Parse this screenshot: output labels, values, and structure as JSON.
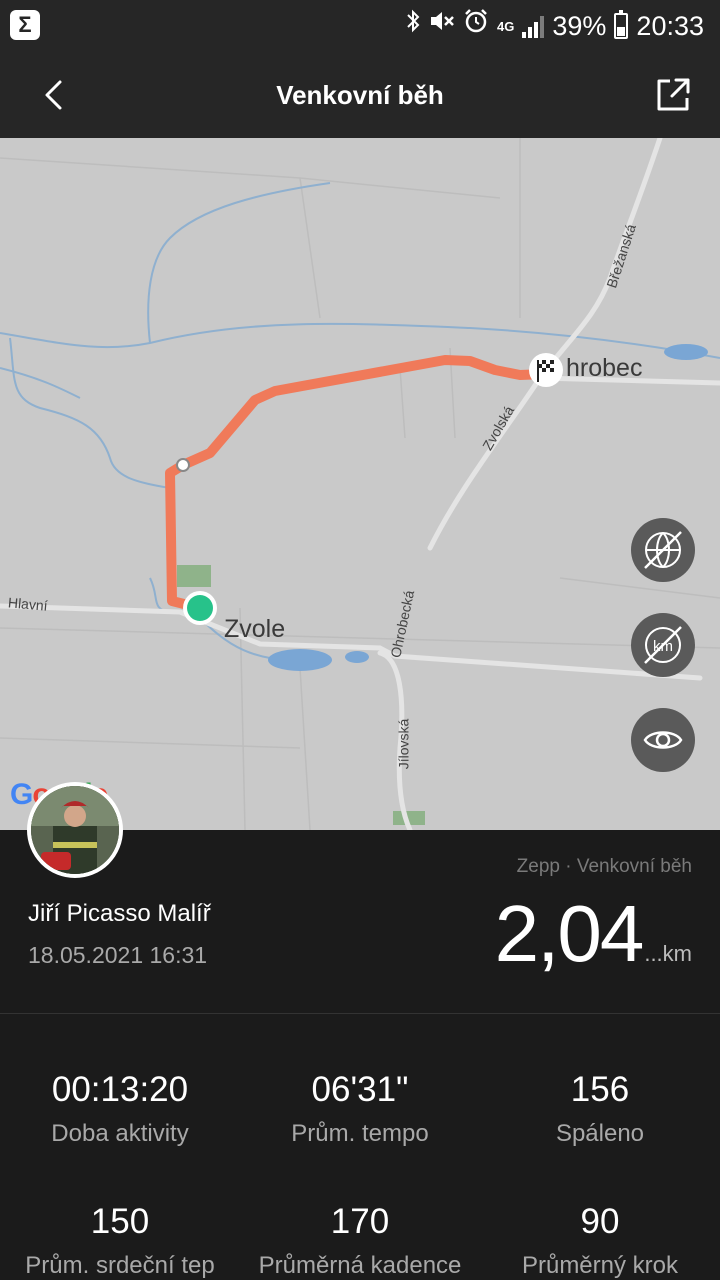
{
  "status_bar": {
    "app_icon": "sigma",
    "icons": [
      "bluetooth-icon",
      "mute-icon",
      "alarm-icon",
      "4g-icon",
      "signal-icon"
    ],
    "network": "4G",
    "battery": "39%",
    "battery_level": 0.39,
    "time": "20:33"
  },
  "header": {
    "title": "Venkovní běh",
    "back_icon": "chevron-left",
    "share_icon": "share-external"
  },
  "map": {
    "places": {
      "start": "Zvole",
      "finish": "hrobec"
    },
    "roads": [
      "Hlavní",
      "Zvolská",
      "Ohrobecká",
      "Jílovská",
      "Břežanská"
    ],
    "attribution": "Google",
    "route_color": "#f07a5a",
    "start_color": "#27c28a",
    "buttons": [
      "map-type-off-icon",
      "km-markers-off-icon",
      "visibility-icon"
    ]
  },
  "workout": {
    "user_name": "Jiří Picasso Malíř",
    "datetime": "18.05.2021 16:31",
    "source": "Zepp · Venkovní běh",
    "distance": "2,04",
    "distance_unit": "...km"
  },
  "stats": [
    {
      "value": "00:13:20",
      "label": "Doba aktivity"
    },
    {
      "value": "06'31\"",
      "label": "Prům. tempo"
    },
    {
      "value": "156",
      "label": "Spáleno"
    },
    {
      "value": "150",
      "label": "Prům. srdeční tep"
    },
    {
      "value": "170",
      "label": "Průměrná kadence"
    },
    {
      "value": "90",
      "label": "Průměrný krok"
    }
  ]
}
